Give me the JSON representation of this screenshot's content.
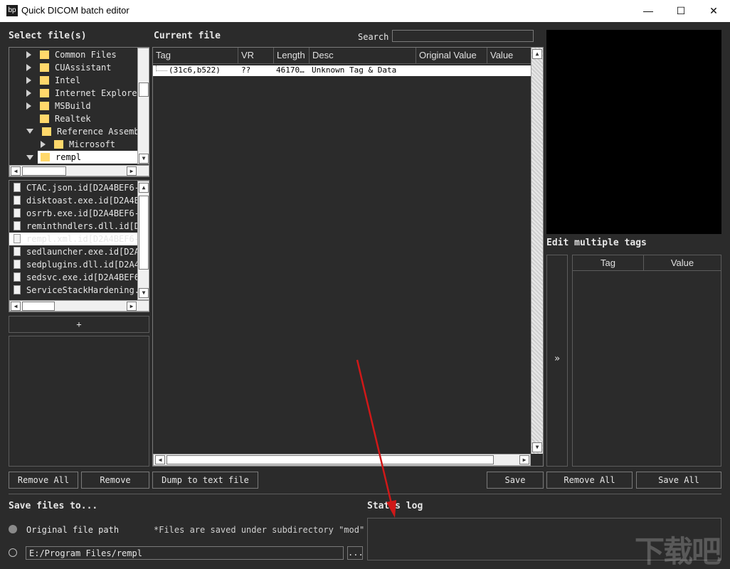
{
  "window": {
    "title": "Quick DICOM batch editor",
    "icon_text": "bp",
    "minimize": "—",
    "maximize": "☐",
    "close": "✕"
  },
  "left": {
    "select_label": "Select file(s)",
    "tree": [
      {
        "label": "Common Files",
        "state": "collapsed",
        "indent": 0
      },
      {
        "label": "CUAssistant",
        "state": "collapsed",
        "indent": 0
      },
      {
        "label": "Intel",
        "state": "collapsed",
        "indent": 0
      },
      {
        "label": "Internet Explorer",
        "state": "collapsed",
        "indent": 0
      },
      {
        "label": "MSBuild",
        "state": "collapsed",
        "indent": 0
      },
      {
        "label": "Realtek",
        "state": "leaf",
        "indent": 0
      },
      {
        "label": "Reference Assembl",
        "state": "expanded",
        "indent": 0
      },
      {
        "label": "Microsoft",
        "state": "collapsed",
        "indent": 1
      },
      {
        "label": "rempl",
        "state": "expanded",
        "indent": 0,
        "selected": true
      }
    ],
    "files": [
      {
        "label": "CTAC.json.id[D2A4BEF6-"
      },
      {
        "label": "disktoast.exe.id[D2A4B"
      },
      {
        "label": "osrrb.exe.id[D2A4BEF6-"
      },
      {
        "label": "reminthndlers.dll.id[D"
      },
      {
        "label": "rempl.xml.id[D2A4BEF6-",
        "selected": true
      },
      {
        "label": "sedlauncher.exe.id[D2A"
      },
      {
        "label": "sedplugins.dll.id[D2A4"
      },
      {
        "label": "sedsvc.exe.id[D2A4BEF6"
      },
      {
        "label": "ServiceStackHardening."
      }
    ],
    "add_label": "+",
    "remove_all_label": "Remove All",
    "remove_label": "Remove"
  },
  "center": {
    "current_file_label": "Current file",
    "search_label": "Search",
    "search_value": "",
    "columns": [
      "Tag",
      "VR",
      "Length",
      "Desc",
      "Original Value",
      "Value"
    ],
    "rows": [
      {
        "tag": "(31c6,b522)",
        "vr": "??",
        "length": "46170…",
        "desc": "Unknown Tag & Data",
        "original": "",
        "value": ""
      }
    ],
    "dump_label": "Dump to text file",
    "save_label": "Save"
  },
  "right": {
    "edit_multiple_label": "Edit multiple tags",
    "columns": [
      "Tag",
      "Value"
    ],
    "transfer_label": "»",
    "remove_all_label": "Remove All",
    "save_all_label": "Save All"
  },
  "bottom": {
    "save_files_label": "Save files to...",
    "original_path_label": "Original file path",
    "note": "*Files are saved under subdirectory \"mod\"",
    "path_value": "E:/Program Files/rempl",
    "browse_label": "...",
    "status_log_label": "Status log"
  },
  "watermark": "下载吧"
}
